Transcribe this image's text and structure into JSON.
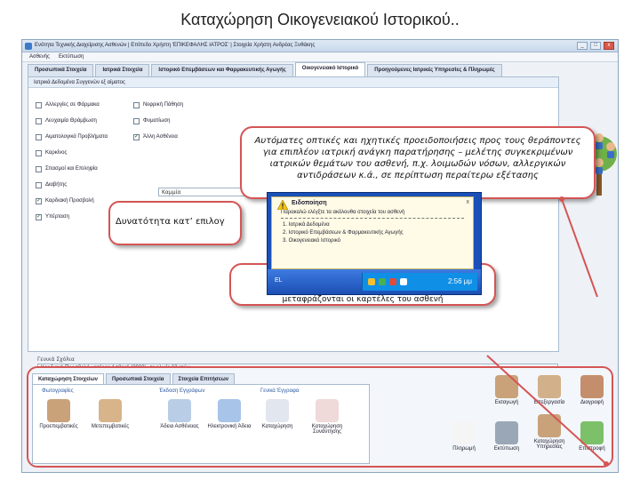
{
  "slide": {
    "title": "Καταχώρηση Οικογενειακού Ιστορικού.."
  },
  "window": {
    "title": "Ενότητα Τεχνικής Διαχείρισης Ασθενών | Επίπεδο Χρήστη 'ΕΠΙΚΕΦΑΛΗΣ ΙΑΤΡΟΣ' | Στοιχεία Χρήστη Ανδρέας Ξυθάκης",
    "min": "_",
    "max": "□",
    "close": "x"
  },
  "menu": [
    "Ασθενής",
    "Εκτύπωση"
  ],
  "tabs": [
    {
      "label": "Προσωπικά Στοιχεία"
    },
    {
      "label": "Ιατρικά Στοιχεία"
    },
    {
      "label": "Ιστορικό Επεμβάσεων και Φαρμακευτικής Αγωγής"
    },
    {
      "label": "Οικογενειακό Ιστορικό"
    },
    {
      "label": "Προηγούμενες Ιατρικές Υπηρεσίες & Πληρωμές"
    }
  ],
  "panel": {
    "header": "Ιατρικά Δεδομένα Συγγενών εξ αίματος",
    "left_checks": [
      {
        "label": "Αλλεργίες σε Φάρμακα",
        "checked": false,
        "mark": ""
      },
      {
        "label": "Λευχαιμία Θράμβωση",
        "checked": false,
        "mark": ""
      },
      {
        "label": "Αιματολογικά Προβλήματα",
        "checked": false,
        "mark": ""
      },
      {
        "label": "Καρκίνος",
        "checked": false,
        "mark": ""
      },
      {
        "label": "Σπασμοί και Επιληψία",
        "checked": false,
        "mark": ""
      },
      {
        "label": "Διαβήτης",
        "checked": false,
        "mark": ""
      },
      {
        "label": "Καρδιακή Προσβολή",
        "checked": true,
        "mark": "✓"
      },
      {
        "label": "Υπέρταση",
        "checked": true,
        "mark": "✓"
      }
    ],
    "right_checks": [
      {
        "label": "Νεφρική Πάθηση",
        "checked": false,
        "mark": ""
      },
      {
        "label": "Φυματίωση",
        "checked": false,
        "mark": ""
      },
      {
        "label": "Άλλη Ασθένεια",
        "checked": true,
        "mark": "✓"
      }
    ],
    "other_field": "Καμμία",
    "notes_label": "Γενικά Σχόλια",
    "notes_value": "Καρδιακή Προσβολή μητέρας Ασθενή (2003), σε ηλικία 62 ετών."
  },
  "bottom": {
    "tabs": [
      "Καταχώρηση Στοιχείων",
      "Προσωπικά Στοιχεία",
      "Στοιχεία Επιτήσεων"
    ],
    "groups": {
      "photos": "Φωτογραφίες",
      "documents": "Έκδοση Εγγράφων",
      "general": "Γενικά Έγγραφα"
    },
    "buttons": {
      "pre_op": "Προεπεμβατικές",
      "post_op": "Μετεπεμβατικές",
      "sick_leave": "Άδεια Ασθένειας",
      "e_prescription": "Ηλεκτρονική Άδεια",
      "general_docs": "Καταχώρηση",
      "appointment": "Καταχώρηση Συνάντησης"
    },
    "right_buttons": {
      "insert": "Εισαγωγή",
      "edit": "Επεξεργασία",
      "delete": "Διαγραφή",
      "payment": "Πληρωμή",
      "print": "Εκτύπωση",
      "service": "Καταχώρηση Υπηρεσίας",
      "back": "Επιστροφή"
    }
  },
  "callouts": {
    "main": "Αυτόματες οπτικές και ηχητικές προειδοποιήσεις προς τους θεράποντες για επιπλέον ιατρική ανάγκη παρατήρησης – μελέτης συγκεκριμένων ιατρικών θεμάτων του ασθενή, π.χ. λοιμωδών νόσων, αλλεργικών αντιδράσεων κ.ά., σε περίπτωση περαίτερω εξέτασης",
    "left": "Δυνατότητα κατ’ επιλογ",
    "mid": "μεταφράζονται οι καρτέλες του ασθενή"
  },
  "popup": {
    "title": "Ειδοποίηση",
    "close": "x",
    "message": "Παρακαλώ ελέγξτε τα ακόλουθα στοιχεία του ασθενή",
    "items": [
      "1. Ιατρικά Δεδομένα",
      "2. Ιστορικό Επεμβάσεων & Φαρμακευτικής Αγωγής",
      "3. Οικογενειακό Ιστορικό"
    ],
    "lang": "EL",
    "clock": "2:56 μμ"
  },
  "colors": {
    "accent": "#d45555",
    "window_bg": "#eef2f7",
    "taskbar": "#1c4fb4"
  }
}
